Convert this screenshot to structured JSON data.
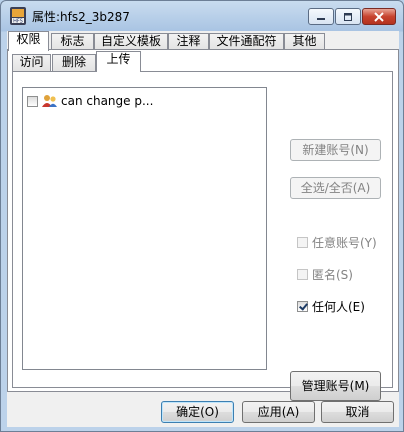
{
  "window": {
    "title": "属性:hfs2_3b287",
    "controls": {
      "minimize": "minimize",
      "maximize": "maximize",
      "close": "close"
    }
  },
  "main_tabs": [
    {
      "label": "权限"
    },
    {
      "label": "标志"
    },
    {
      "label": "自定义模板"
    },
    {
      "label": "注释"
    },
    {
      "label": "文件通配符"
    },
    {
      "label": "其他"
    }
  ],
  "sub_tabs": [
    {
      "label": "访问"
    },
    {
      "label": "删除"
    },
    {
      "label": "上传"
    }
  ],
  "accounts_list": [
    {
      "label": "can change p...",
      "checked": false
    }
  ],
  "buttons": {
    "new_account": "新建账号(N)",
    "select_all": "全选/全否(A)",
    "manage_accounts": "管理账号(M)",
    "ok": "确定(O)",
    "apply": "应用(A)",
    "cancel": "取消"
  },
  "options": {
    "any_account": {
      "label": "任意账号(Y)",
      "checked": false,
      "enabled": false
    },
    "anonymous": {
      "label": "匿名(S)",
      "checked": false,
      "enabled": false
    },
    "anyone": {
      "label": "任何人(E)",
      "checked": true,
      "enabled": true
    }
  },
  "colors": {
    "title_bar": "#b9d1ea",
    "close_button": "#c7432f",
    "dialog_background": "#f0f0f0"
  }
}
